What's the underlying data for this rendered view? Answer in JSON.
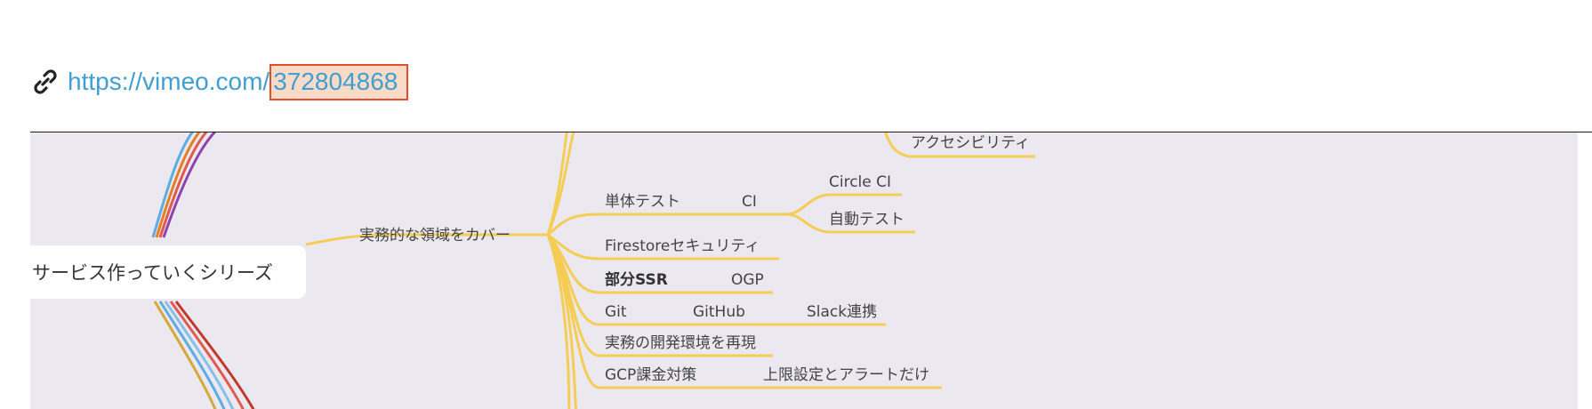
{
  "link": {
    "prefix": "https://vimeo.com/",
    "id": "372804868",
    "icon": "link-icon"
  },
  "mindmap": {
    "root": "サービス作っていくシリーズ",
    "branch": "実務的な領域をカバー",
    "nodes": {
      "accessibility": "アクセシビリティ",
      "unit_test": "単体テスト",
      "ci": "CI",
      "circle_ci": "Circle CI",
      "auto_test": "自動テスト",
      "firestore": "Firestoreセキュリティ",
      "partial_ssr": "部分SSR",
      "ogp": "OGP",
      "git": "Git",
      "github": "GitHub",
      "slack": "Slack連携",
      "dev_env": "実務の開発環境を再現",
      "gcp": "GCP課金対策",
      "limit": "上限設定とアラートだけ"
    },
    "colors": {
      "branch": "#f5cd55",
      "mindmap_bg": "#ebe9ef",
      "link": "#3f9fd3",
      "highlight_fill": "#f9dbc7",
      "highlight_border": "#e24d2d"
    }
  }
}
